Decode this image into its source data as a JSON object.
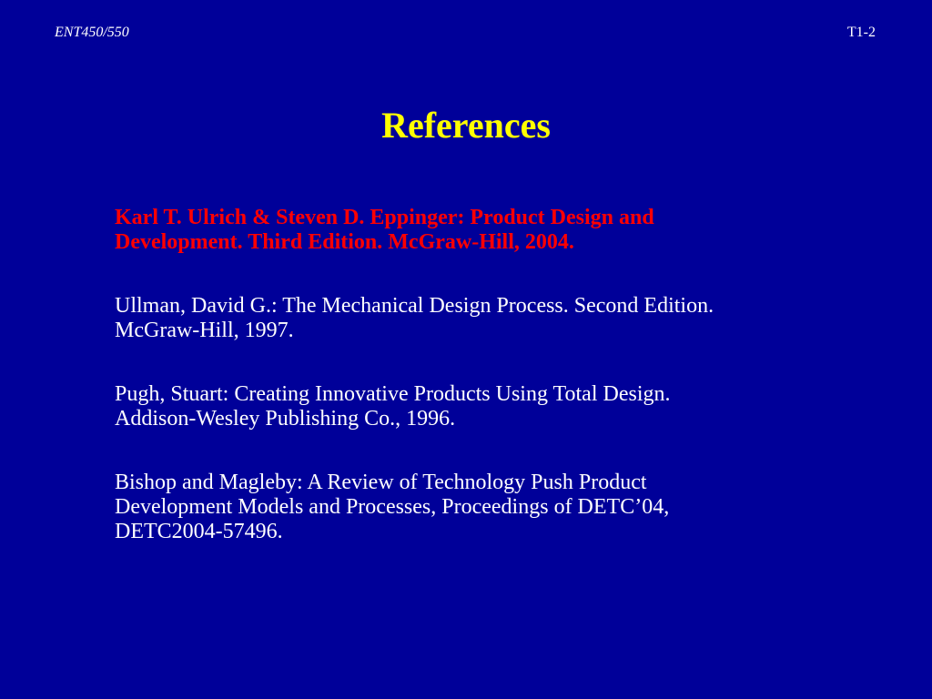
{
  "header": {
    "course": "ENT450/550",
    "slide_number": "T1-2"
  },
  "title": "References",
  "colors": {
    "background": "#000099",
    "title": "#ffff00",
    "highlight": "#ff0000",
    "text": "#ffffff"
  },
  "references": [
    {
      "text": "Karl T. Ulrich & Steven D. Eppinger: Product Design and\nDevelopment. Third Edition. McGraw-Hill, 2004."
    },
    {
      "text": "Ullman, David G.: The Mechanical Design Process. Second Edition.\nMcGraw-Hill, 1997."
    },
    {
      "text": "Pugh, Stuart: Creating Innovative Products Using Total Design.\nAddison-Wesley Publishing Co., 1996."
    },
    {
      "text": "Bishop and Magleby:  A Review of Technology Push Product\nDevelopment Models and Processes, Proceedings of DETC’04,\nDETC2004-57496."
    }
  ]
}
